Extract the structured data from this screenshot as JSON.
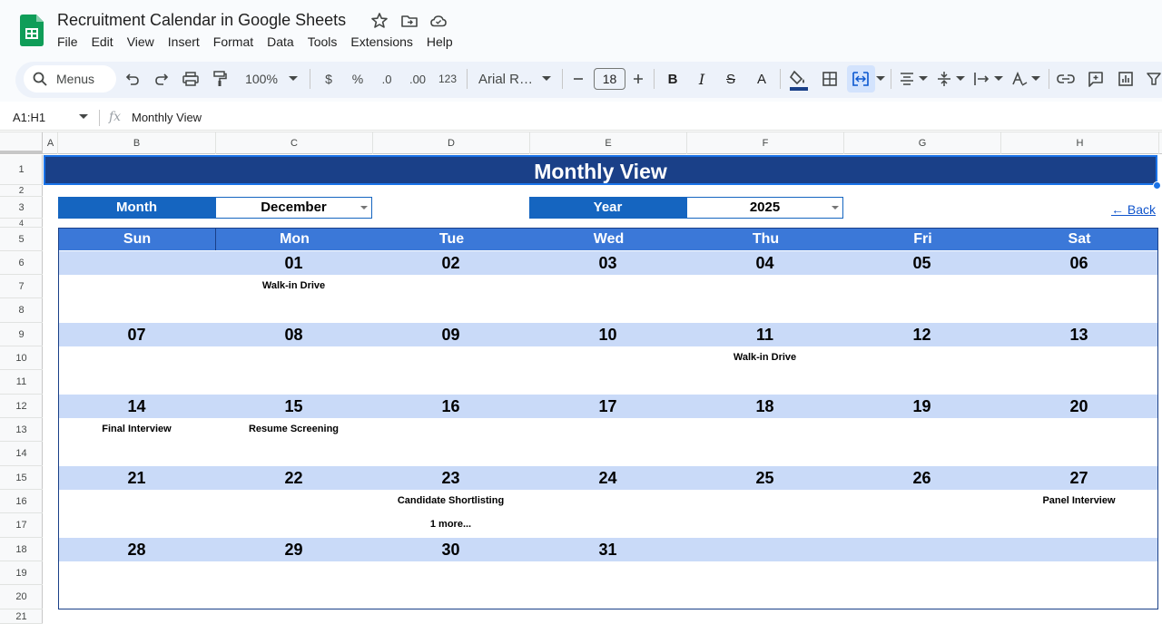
{
  "window": {
    "title": "Recruitment Calendar in Google Sheets",
    "menu": [
      "File",
      "Edit",
      "View",
      "Insert",
      "Format",
      "Data",
      "Tools",
      "Extensions",
      "Help"
    ]
  },
  "toolbar": {
    "search_label": "Menus",
    "zoom": "100%",
    "currency": "$",
    "percent": "%",
    "decrease_decimal": ".0",
    "increase_decimal": ".00",
    "number_format": "123",
    "font": "Arial R…",
    "font_size": "18",
    "bold": "B",
    "italic": "I",
    "strike": "S",
    "text_color": "A"
  },
  "formula_bar": {
    "name_box": "A1:H1",
    "fx": "fx",
    "content": "Monthly View"
  },
  "grid": {
    "columns": [
      "A",
      "B",
      "C",
      "D",
      "E",
      "F",
      "G",
      "H"
    ],
    "rows": [
      "1",
      "2",
      "3",
      "4",
      "5",
      "6",
      "7",
      "8",
      "9",
      "10",
      "11",
      "12",
      "13",
      "14",
      "15",
      "16",
      "17",
      "18",
      "19",
      "20",
      "21"
    ]
  },
  "sheet": {
    "title": "Monthly View",
    "month_label": "Month",
    "month_value": "December",
    "year_label": "Year",
    "year_value": "2025",
    "back_link": "← Back",
    "weekdays": [
      "Sun",
      "Mon",
      "Tue",
      "Wed",
      "Thu",
      "Fri",
      "Sat"
    ],
    "weeks": [
      {
        "dates": [
          "",
          "01",
          "02",
          "03",
          "04",
          "05",
          "06"
        ],
        "line1": [
          "",
          "Walk-in Drive",
          "",
          "",
          "",
          "",
          ""
        ],
        "line2": [
          "",
          "",
          "",
          "",
          "",
          "",
          ""
        ]
      },
      {
        "dates": [
          "07",
          "08",
          "09",
          "10",
          "11",
          "12",
          "13"
        ],
        "line1": [
          "",
          "",
          "",
          "",
          "Walk-in Drive",
          "",
          ""
        ],
        "line2": [
          "",
          "",
          "",
          "",
          "",
          "",
          ""
        ]
      },
      {
        "dates": [
          "14",
          "15",
          "16",
          "17",
          "18",
          "19",
          "20"
        ],
        "line1": [
          "Final Interview",
          "Resume Screening",
          "",
          "",
          "",
          "",
          ""
        ],
        "line2": [
          "",
          "",
          "",
          "",
          "",
          "",
          ""
        ]
      },
      {
        "dates": [
          "21",
          "22",
          "23",
          "24",
          "25",
          "26",
          "27"
        ],
        "line1": [
          "",
          "",
          "Candidate Shortlisting",
          "",
          "",
          "",
          "Panel Interview"
        ],
        "line2": [
          "",
          "",
          "1 more...",
          "",
          "",
          "",
          ""
        ]
      },
      {
        "dates": [
          "28",
          "29",
          "30",
          "31",
          "",
          "",
          ""
        ],
        "line1": [
          "",
          "",
          "",
          "",
          "",
          "",
          ""
        ],
        "line2": [
          "",
          "",
          "",
          "",
          "",
          "",
          ""
        ]
      }
    ]
  },
  "colors": {
    "banner": "#1a4088",
    "label_fill": "#1565c0",
    "weekday_fill": "#3b78d8",
    "date_band": "#c9daf8",
    "link": "#1155cc"
  }
}
